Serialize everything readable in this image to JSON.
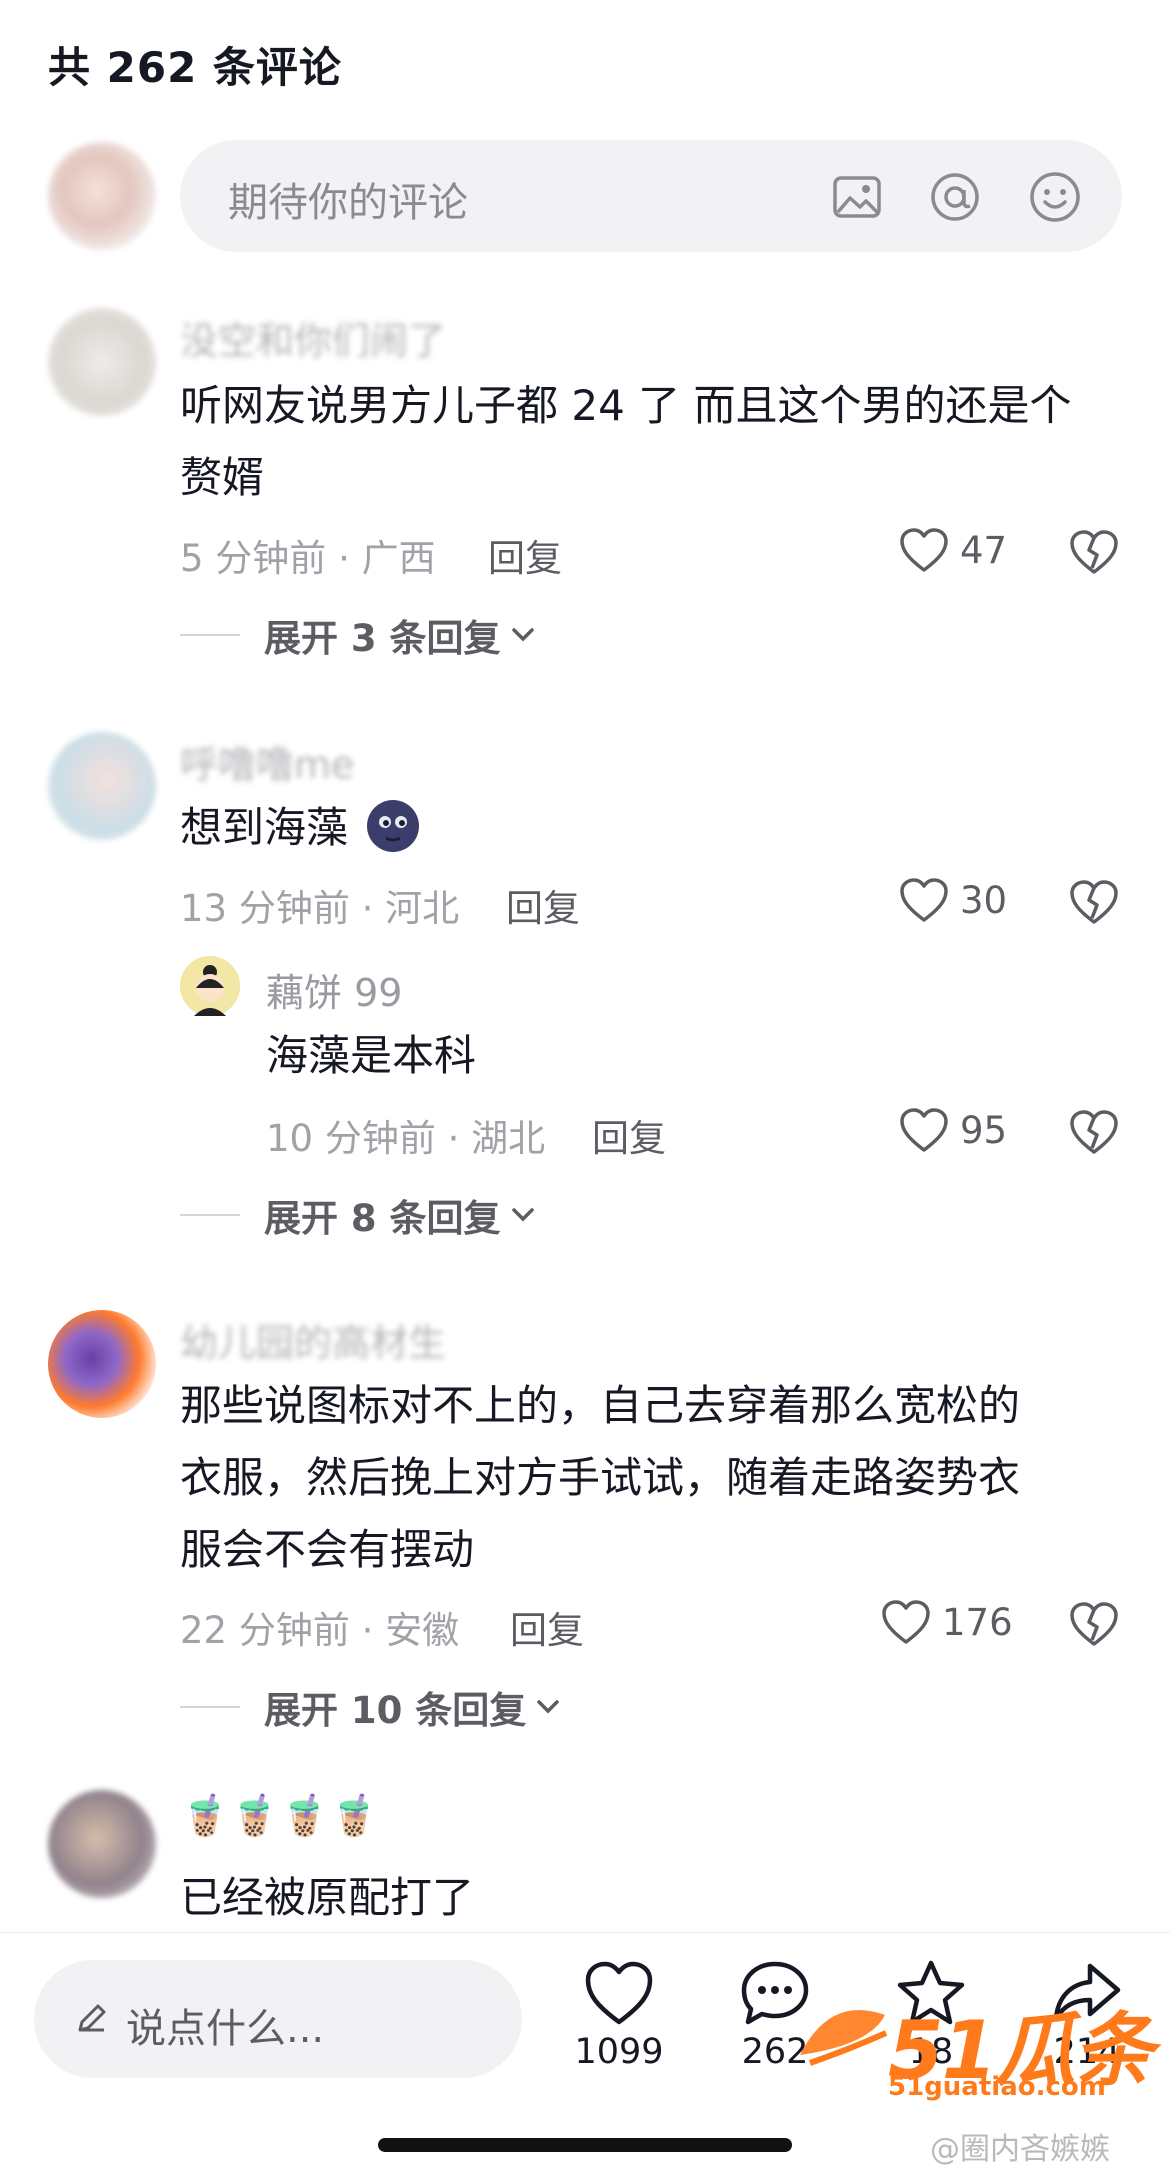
{
  "header": {
    "title": "共 262 条评论"
  },
  "comment_input": {
    "placeholder": "期待你的评论",
    "icons": [
      "image-icon",
      "at-icon",
      "emoji-icon"
    ]
  },
  "comments": [
    {
      "username": "没空和你们闹了",
      "text_lines": [
        "听网友说男方儿子都 24 了 而且这个男的还是个",
        "赘婿"
      ],
      "meta": "5 分钟前 · 广西",
      "reply_label": "回复",
      "likes": "47",
      "expand_label": "展开 3 条回复"
    },
    {
      "username": "呼噜噜me",
      "text_lines": [
        "想到海藻"
      ],
      "meta": "13 分钟前 · 河北",
      "reply_label": "回复",
      "likes": "30",
      "reply": {
        "username": "藕饼 99",
        "text": "海藻是本科",
        "meta": "10 分钟前 · 湖北",
        "reply_label": "回复",
        "likes": "95"
      },
      "expand_label": "展开 8 条回复"
    },
    {
      "username": "幼儿园的高材生",
      "text_lines": [
        "那些说图标对不上的，自己去穿着那么宽松的",
        "衣服，然后挽上对方手试试，随着走路姿势衣",
        "服会不会有摆动"
      ],
      "meta": "22 分钟前 · 安徽",
      "reply_label": "回复",
      "likes": "176",
      "expand_label": "展开 10 条回复"
    },
    {
      "username": "🧋🧋🧋🧋",
      "text_lines": [
        "已经被原配打了"
      ]
    }
  ],
  "bottom_bar": {
    "input_placeholder": "说点什么...",
    "likes": "1099",
    "comments": "262",
    "favorites": "18",
    "shares": "214"
  },
  "watermark": {
    "brand": "51瓜条",
    "site": "51guatiao.com",
    "handle": "@圈内吝嫉嫉"
  },
  "colors": {
    "text": "#161823",
    "secondary": "#a1a2a7",
    "input_bg": "#f2f2f4",
    "watermark": "#ff7a1a"
  }
}
